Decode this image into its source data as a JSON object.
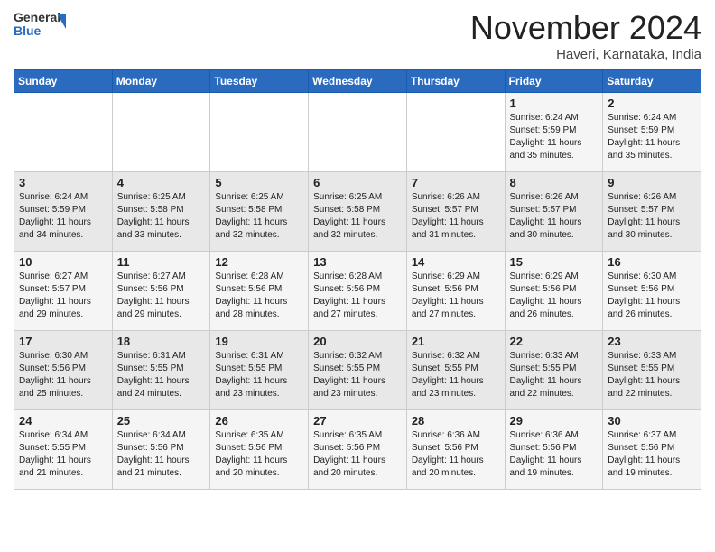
{
  "logo": {
    "general": "General",
    "blue": "Blue"
  },
  "header": {
    "month": "November 2024",
    "location": "Haveri, Karnataka, India"
  },
  "days_of_week": [
    "Sunday",
    "Monday",
    "Tuesday",
    "Wednesday",
    "Thursday",
    "Friday",
    "Saturday"
  ],
  "weeks": [
    [
      {
        "day": "",
        "info": ""
      },
      {
        "day": "",
        "info": ""
      },
      {
        "day": "",
        "info": ""
      },
      {
        "day": "",
        "info": ""
      },
      {
        "day": "",
        "info": ""
      },
      {
        "day": "1",
        "info": "Sunrise: 6:24 AM\nSunset: 5:59 PM\nDaylight: 11 hours\nand 35 minutes."
      },
      {
        "day": "2",
        "info": "Sunrise: 6:24 AM\nSunset: 5:59 PM\nDaylight: 11 hours\nand 35 minutes."
      }
    ],
    [
      {
        "day": "3",
        "info": "Sunrise: 6:24 AM\nSunset: 5:59 PM\nDaylight: 11 hours\nand 34 minutes."
      },
      {
        "day": "4",
        "info": "Sunrise: 6:25 AM\nSunset: 5:58 PM\nDaylight: 11 hours\nand 33 minutes."
      },
      {
        "day": "5",
        "info": "Sunrise: 6:25 AM\nSunset: 5:58 PM\nDaylight: 11 hours\nand 32 minutes."
      },
      {
        "day": "6",
        "info": "Sunrise: 6:25 AM\nSunset: 5:58 PM\nDaylight: 11 hours\nand 32 minutes."
      },
      {
        "day": "7",
        "info": "Sunrise: 6:26 AM\nSunset: 5:57 PM\nDaylight: 11 hours\nand 31 minutes."
      },
      {
        "day": "8",
        "info": "Sunrise: 6:26 AM\nSunset: 5:57 PM\nDaylight: 11 hours\nand 30 minutes."
      },
      {
        "day": "9",
        "info": "Sunrise: 6:26 AM\nSunset: 5:57 PM\nDaylight: 11 hours\nand 30 minutes."
      }
    ],
    [
      {
        "day": "10",
        "info": "Sunrise: 6:27 AM\nSunset: 5:57 PM\nDaylight: 11 hours\nand 29 minutes."
      },
      {
        "day": "11",
        "info": "Sunrise: 6:27 AM\nSunset: 5:56 PM\nDaylight: 11 hours\nand 29 minutes."
      },
      {
        "day": "12",
        "info": "Sunrise: 6:28 AM\nSunset: 5:56 PM\nDaylight: 11 hours\nand 28 minutes."
      },
      {
        "day": "13",
        "info": "Sunrise: 6:28 AM\nSunset: 5:56 PM\nDaylight: 11 hours\nand 27 minutes."
      },
      {
        "day": "14",
        "info": "Sunrise: 6:29 AM\nSunset: 5:56 PM\nDaylight: 11 hours\nand 27 minutes."
      },
      {
        "day": "15",
        "info": "Sunrise: 6:29 AM\nSunset: 5:56 PM\nDaylight: 11 hours\nand 26 minutes."
      },
      {
        "day": "16",
        "info": "Sunrise: 6:30 AM\nSunset: 5:56 PM\nDaylight: 11 hours\nand 26 minutes."
      }
    ],
    [
      {
        "day": "17",
        "info": "Sunrise: 6:30 AM\nSunset: 5:56 PM\nDaylight: 11 hours\nand 25 minutes."
      },
      {
        "day": "18",
        "info": "Sunrise: 6:31 AM\nSunset: 5:55 PM\nDaylight: 11 hours\nand 24 minutes."
      },
      {
        "day": "19",
        "info": "Sunrise: 6:31 AM\nSunset: 5:55 PM\nDaylight: 11 hours\nand 23 minutes."
      },
      {
        "day": "20",
        "info": "Sunrise: 6:32 AM\nSunset: 5:55 PM\nDaylight: 11 hours\nand 23 minutes."
      },
      {
        "day": "21",
        "info": "Sunrise: 6:32 AM\nSunset: 5:55 PM\nDaylight: 11 hours\nand 23 minutes."
      },
      {
        "day": "22",
        "info": "Sunrise: 6:33 AM\nSunset: 5:55 PM\nDaylight: 11 hours\nand 22 minutes."
      },
      {
        "day": "23",
        "info": "Sunrise: 6:33 AM\nSunset: 5:55 PM\nDaylight: 11 hours\nand 22 minutes."
      }
    ],
    [
      {
        "day": "24",
        "info": "Sunrise: 6:34 AM\nSunset: 5:55 PM\nDaylight: 11 hours\nand 21 minutes."
      },
      {
        "day": "25",
        "info": "Sunrise: 6:34 AM\nSunset: 5:56 PM\nDaylight: 11 hours\nand 21 minutes."
      },
      {
        "day": "26",
        "info": "Sunrise: 6:35 AM\nSunset: 5:56 PM\nDaylight: 11 hours\nand 20 minutes."
      },
      {
        "day": "27",
        "info": "Sunrise: 6:35 AM\nSunset: 5:56 PM\nDaylight: 11 hours\nand 20 minutes."
      },
      {
        "day": "28",
        "info": "Sunrise: 6:36 AM\nSunset: 5:56 PM\nDaylight: 11 hours\nand 20 minutes."
      },
      {
        "day": "29",
        "info": "Sunrise: 6:36 AM\nSunset: 5:56 PM\nDaylight: 11 hours\nand 19 minutes."
      },
      {
        "day": "30",
        "info": "Sunrise: 6:37 AM\nSunset: 5:56 PM\nDaylight: 11 hours\nand 19 minutes."
      }
    ]
  ]
}
